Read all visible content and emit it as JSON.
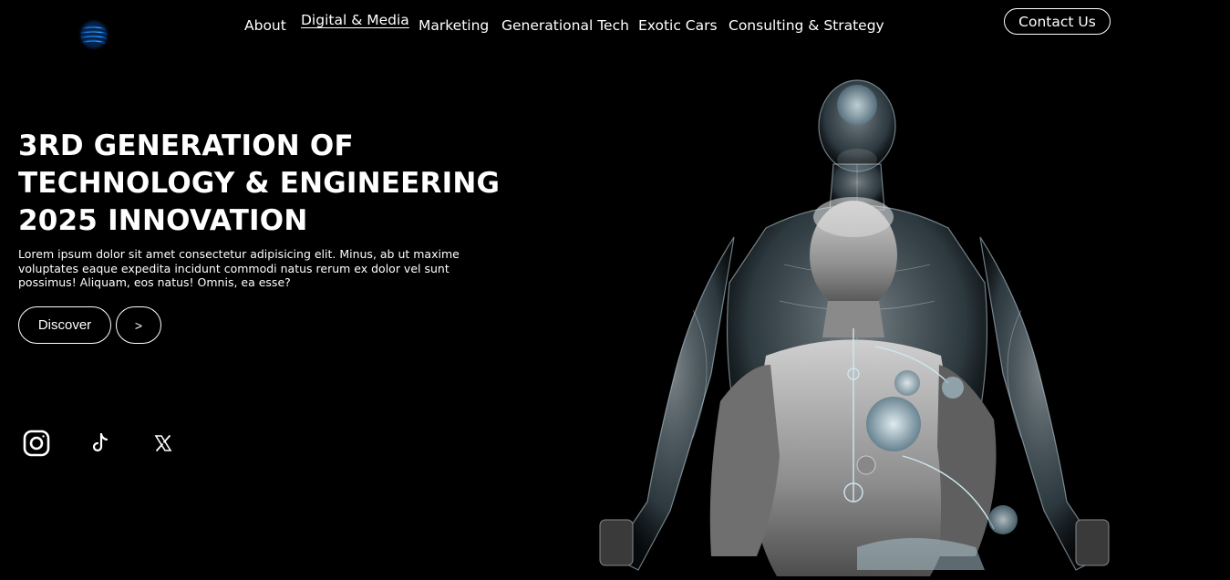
{
  "nav": {
    "items": [
      {
        "label": "About",
        "active": false
      },
      {
        "label": "Digital & Media",
        "active": true
      },
      {
        "label": "Marketing",
        "active": false
      },
      {
        "label": "Generational Tech",
        "active": false
      },
      {
        "label": "Exotic Cars",
        "active": false
      },
      {
        "label": "Consulting & Strategy",
        "active": false
      }
    ],
    "contact_label": "Contact Us"
  },
  "hero": {
    "title_lines": [
      "3RD GENERATION OF",
      "TECHNOLOGY & ENGINEERING",
      "2025 INNOVATION"
    ],
    "description": "Lorem ipsum dolor sit amet consectetur adipisicing elit. Minus, ab ut maxime voluptates eaque expedita incidunt commodi natus rerum ex dolor vel sunt possimus! Aliquam, eos natus! Omnis, ea esse?",
    "discover_label": "Discover",
    "next_label": ">"
  },
  "social": {
    "icons": [
      "instagram-icon",
      "tiktok-icon",
      "x-icon"
    ]
  },
  "colors": {
    "background": "#000000",
    "text": "#ffffff",
    "logo_accent": "#1e90ff"
  }
}
